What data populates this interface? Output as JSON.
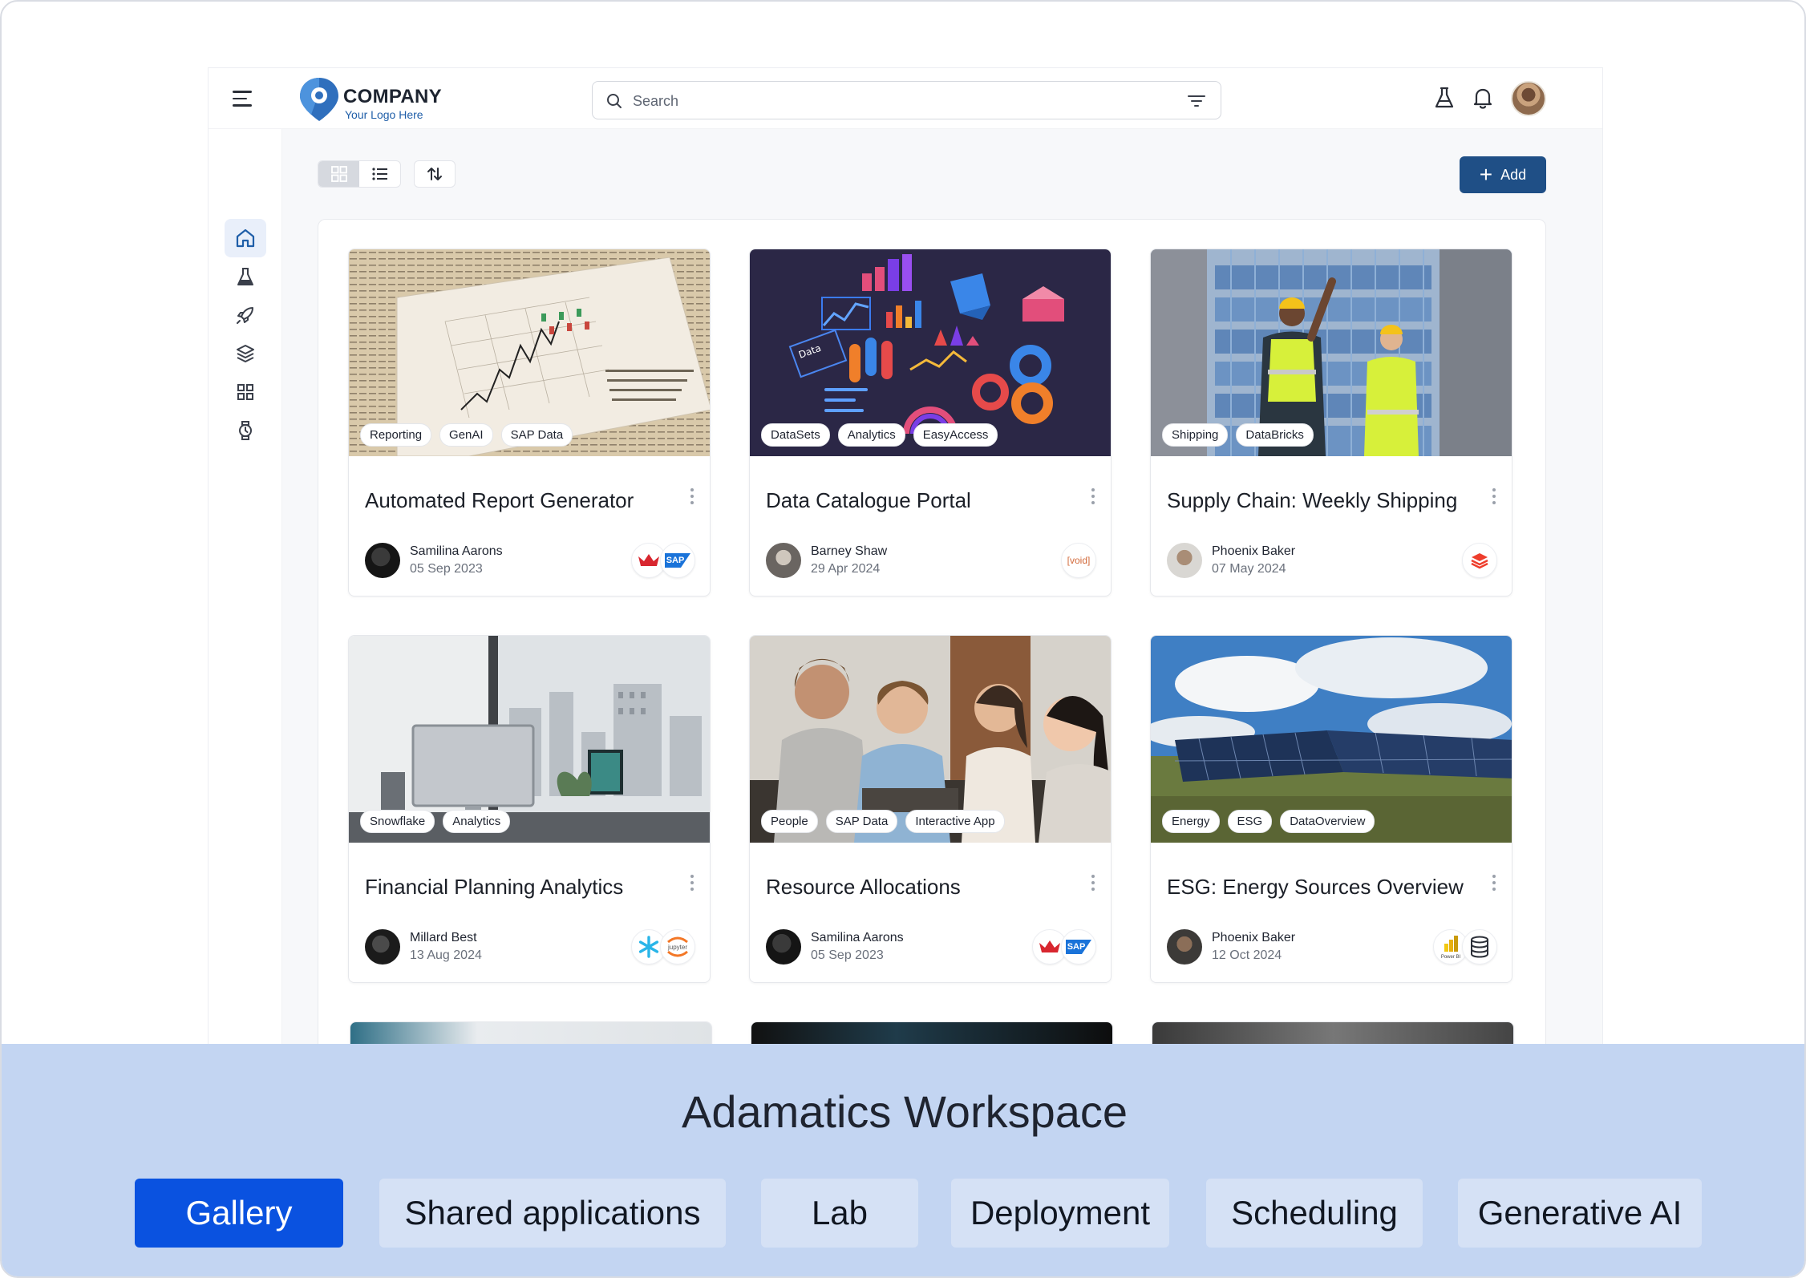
{
  "header": {
    "logo_name": "COMPANY",
    "logo_tagline": "Your Logo Here",
    "search_placeholder": "Search"
  },
  "sidebar": {
    "items": [
      {
        "icon": "home-icon",
        "active": true
      },
      {
        "icon": "flask-icon",
        "active": false
      },
      {
        "icon": "rocket-icon",
        "active": false
      },
      {
        "icon": "layers-icon",
        "active": false
      },
      {
        "icon": "grid-icon",
        "active": false
      },
      {
        "icon": "watch-icon",
        "active": false
      },
      {
        "icon": "gear-icon",
        "active": false
      }
    ]
  },
  "toolbar": {
    "add_label": "Add"
  },
  "cards": [
    {
      "title": "Automated Report Generator",
      "tags": [
        "Reporting",
        "GenAI",
        "SAP Data"
      ],
      "author": "Samilina Aarons",
      "date": "05 Sep 2023",
      "badges": [
        "cluster-icon",
        "sap-logo"
      ],
      "sap_text": "SAP"
    },
    {
      "title": "Data Catalogue Portal",
      "tags": [
        "DataSets",
        "Analytics",
        "EasyAccess"
      ],
      "author": "Barney Shaw",
      "date": "29 Apr 2024",
      "badges": [
        "void-logo"
      ],
      "void_text": "[void]"
    },
    {
      "title": "Supply Chain: Weekly Shipping",
      "tags": [
        "Shipping",
        "DataBricks"
      ],
      "author": "Phoenix Baker",
      "date": "07 May 2024",
      "badges": [
        "databricks-logo"
      ]
    },
    {
      "title": "Financial Planning Analytics",
      "tags": [
        "Snowflake",
        "Analytics"
      ],
      "author": "Millard Best",
      "date": "13 Aug 2024",
      "badges": [
        "snowflake-logo",
        "jupyter-logo"
      ],
      "jupyter_text": "jupyter"
    },
    {
      "title": "Resource Allocations",
      "tags": [
        "People",
        "SAP Data",
        "Interactive App"
      ],
      "author": "Samilina Aarons",
      "date": "05 Sep 2023",
      "badges": [
        "cluster-icon",
        "sap-logo"
      ],
      "sap_text": "SAP"
    },
    {
      "title": "ESG: Energy Sources Overview",
      "tags": [
        "Energy",
        "ESG",
        "DataOverview"
      ],
      "author": "Phoenix Baker",
      "date": "12 Oct 2024",
      "badges": [
        "powerbi-logo",
        "database-icon"
      ],
      "powerbi_text": "Power BI"
    }
  ],
  "band": {
    "title": "Adamatics Workspace",
    "tabs": [
      "Gallery",
      "Shared applications",
      "Lab",
      "Deployment",
      "Scheduling",
      "Generative AI"
    ],
    "active_tab": "Gallery"
  },
  "colors": {
    "accent": "#1f4f86",
    "active_tab": "#0a52e0",
    "band": "#c3d5f2",
    "tab": "#d5e1f5"
  }
}
